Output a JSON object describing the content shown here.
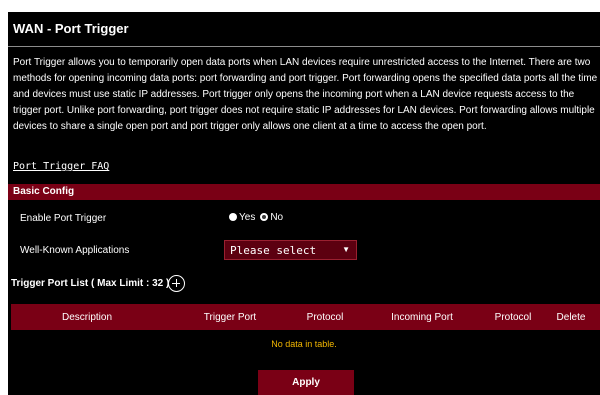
{
  "page": {
    "title": "WAN - Port Trigger",
    "description": "Port Trigger allows you to temporarily open data ports when LAN devices require unrestricted access to the Internet. There are two methods for opening incoming data ports: port forwarding and port trigger. Port forwarding opens the specified data ports all the time and devices must use static IP addresses. Port trigger only opens the incoming port when a LAN device requests access to the trigger port. Unlike port forwarding, port trigger does not require static IP addresses for LAN devices. Port forwarding allows multiple devices to share a single open port and port trigger only allows one client at a time to access the open port.",
    "faq_link": "Port Trigger FAQ"
  },
  "basic_config": {
    "header": "Basic Config",
    "enable_label": "Enable Port Trigger",
    "enable_options": {
      "yes": "Yes",
      "no": "No",
      "selected": "No"
    },
    "apps_label": "Well-Known Applications",
    "apps_select_value": "Please select"
  },
  "trigger_list": {
    "title": "Trigger Port List ( Max Limit : 32 )",
    "columns": [
      "Description",
      "Trigger Port",
      "Protocol",
      "Incoming Port",
      "Protocol",
      "Delete"
    ],
    "empty_message": "No data in table.",
    "rows": []
  },
  "actions": {
    "apply_label": "Apply"
  },
  "icons": {
    "add": "add-circle-icon",
    "dropdown": "chevron-down-icon"
  },
  "colors": {
    "background": "#000000",
    "accent": "#7a0015",
    "empty_text": "#f2b600",
    "text": "#ffffff"
  }
}
